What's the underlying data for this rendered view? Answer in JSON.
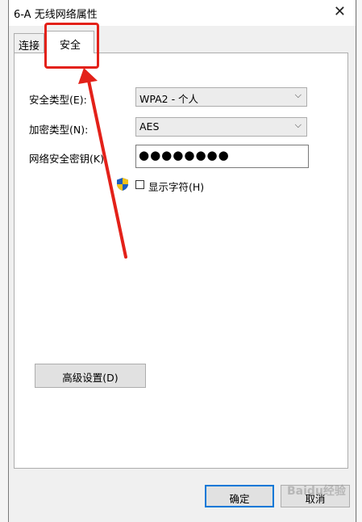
{
  "window": {
    "title": "6-A 无线网络属性",
    "close_glyph": "✕"
  },
  "tabs": [
    {
      "label": "连接",
      "active": false
    },
    {
      "label": "安全",
      "active": true
    }
  ],
  "security": {
    "type_label": "安全类型(E):",
    "type_value": "WPA2 - 个人",
    "encryption_label": "加密类型(N):",
    "encryption_value": "AES",
    "key_label": "网络安全密钥(K)",
    "key_value": "●●●●●●●●",
    "show_chars_label": "显示字符(H)",
    "show_chars_checked": false
  },
  "advanced_button": "高级设置(D)",
  "footer": {
    "ok": "确定",
    "cancel": "取消"
  },
  "watermark": "Baidu经验",
  "colors": {
    "annotation": "#e32119",
    "focus_border": "#0078d7"
  },
  "icons": {
    "shield": "uac-shield-icon",
    "dropdown": "chevron-down-icon"
  }
}
